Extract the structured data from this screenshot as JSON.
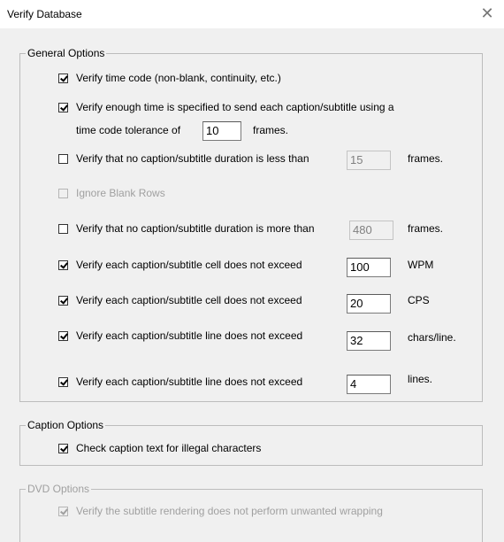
{
  "window": {
    "title": "Verify Database",
    "close_glyph": "✕"
  },
  "general": {
    "legend": "General Options",
    "time_code": {
      "label": "Verify time code (non-blank, continuity, etc.)",
      "checked": true
    },
    "enough_time": {
      "label_line1": "Verify enough time is specified to send each caption/subtitle using a",
      "label_line2": "time code tolerance of",
      "value": "10",
      "unit": "frames.",
      "checked": true
    },
    "min_duration": {
      "label": "Verify that no caption/subtitle duration is less than",
      "value": "15",
      "unit": "frames.",
      "checked": false
    },
    "ignore_blank": {
      "label": "Ignore Blank Rows",
      "checked": false
    },
    "max_duration": {
      "label": "Verify that no caption/subtitle duration is more than",
      "value": "480",
      "unit": "frames.",
      "checked": false
    },
    "wpm": {
      "label": "Verify each caption/subtitle cell does not exceed",
      "value": "100",
      "unit": "WPM",
      "checked": true
    },
    "cps": {
      "label": "Verify each caption/subtitle cell does not exceed",
      "value": "20",
      "unit": "CPS",
      "checked": true
    },
    "chars_line": {
      "label": "Verify each caption/subtitle line does not exceed",
      "value": "32",
      "unit": "chars/line.",
      "checked": true
    },
    "lines": {
      "label": "Verify each caption/subtitle line does not exceed",
      "value": "4",
      "unit": "lines.",
      "checked": true
    }
  },
  "caption": {
    "legend": "Caption Options",
    "illegal_chars": {
      "label": "Check caption text for illegal characters",
      "checked": true
    }
  },
  "dvd": {
    "legend": "DVD Options",
    "wrapping": {
      "label": "Verify the subtitle rendering does not perform unwanted wrapping",
      "checked": true
    }
  }
}
